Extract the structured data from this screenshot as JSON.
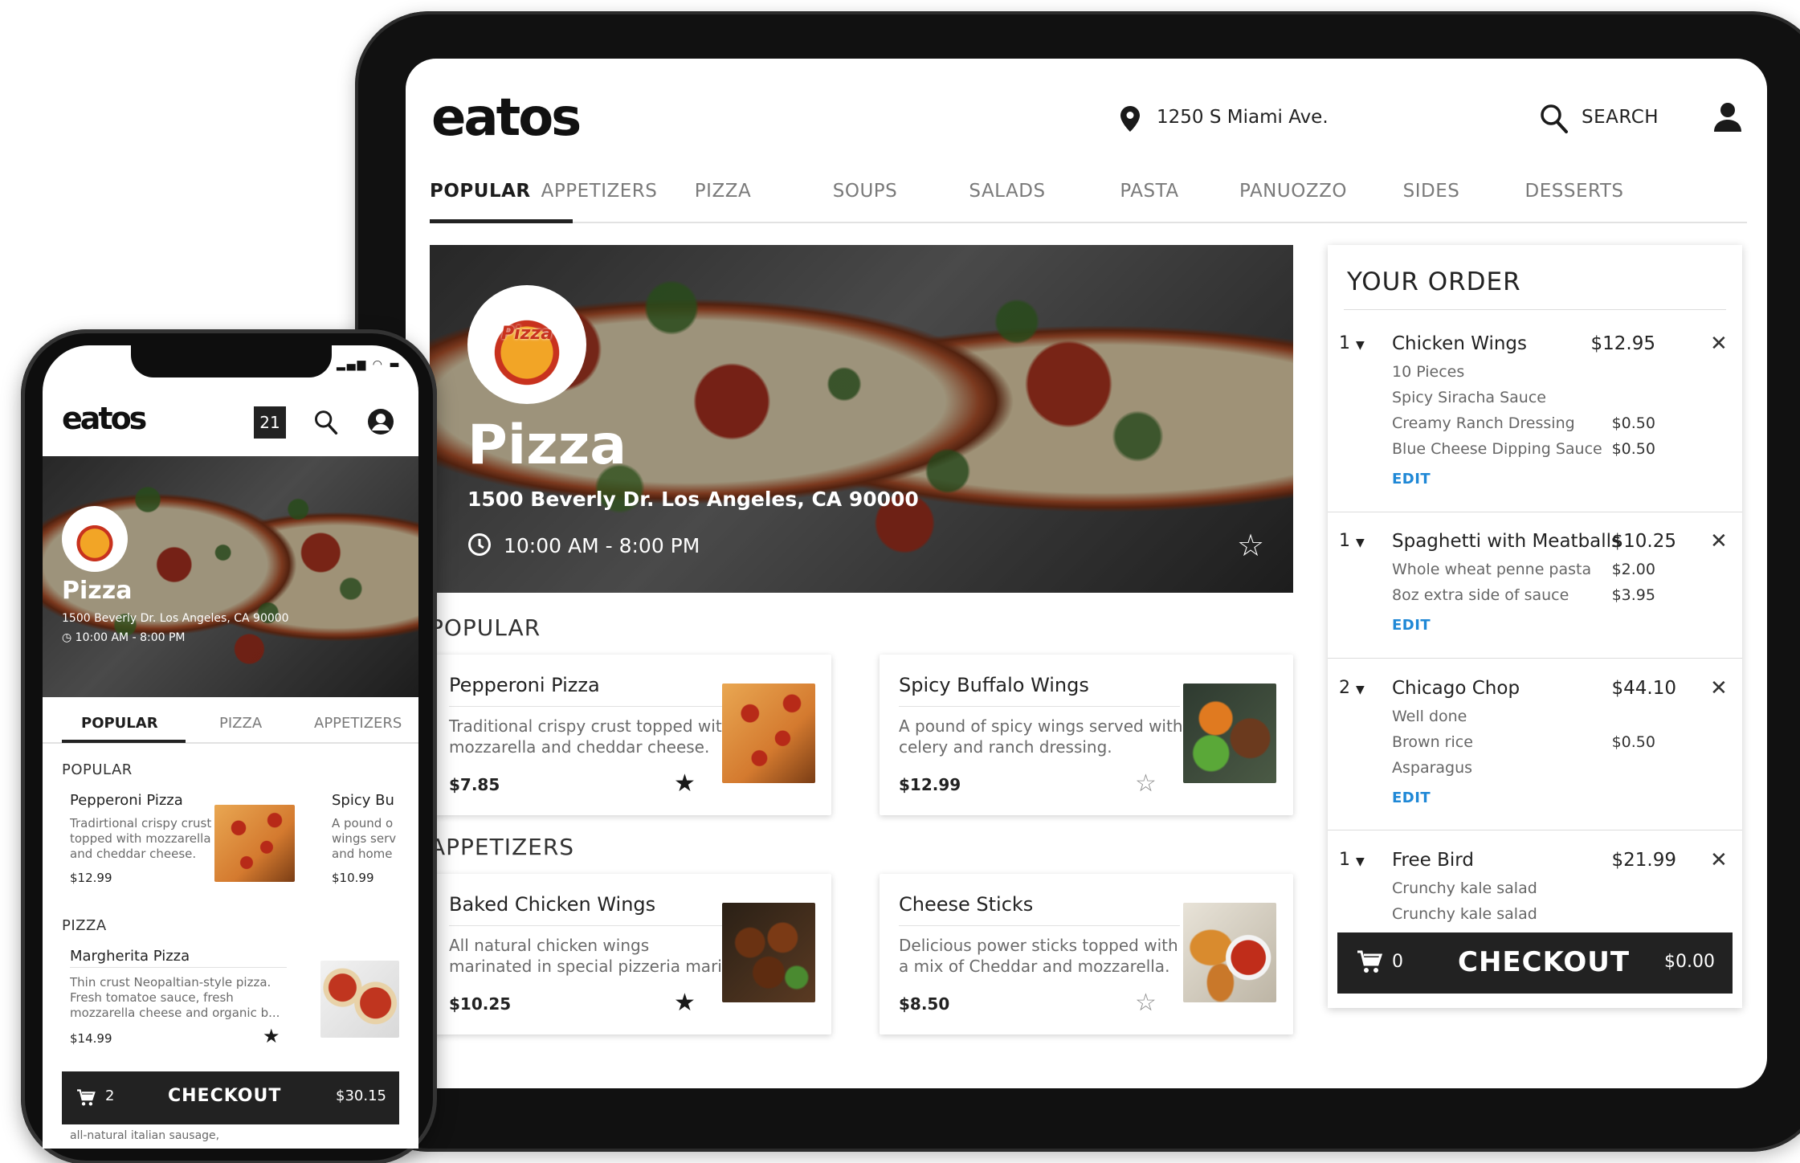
{
  "tablet": {
    "logo": "eatos",
    "address": "1250 S Miami Ave.",
    "search_label": "SEARCH",
    "tabs": [
      "POPULAR",
      "APPETIZERS",
      "PIZZA",
      "SOUPS",
      "SALADS",
      "PASTA",
      "PANUOZZO",
      "SIDES",
      "DESSERTS"
    ],
    "hero": {
      "badge_text": "Pizza",
      "title": "Pizza",
      "address": "1500 Beverly Dr. Los Angeles, CA 90000",
      "hours": "10:00 AM - 8:00 PM"
    },
    "sections": [
      {
        "title": "POPULAR",
        "items": [
          {
            "name": "Pepperoni Pizza",
            "desc1": "Traditional crispy crust topped with",
            "desc2": "mozzarella and cheddar cheese.",
            "price": "$7.85"
          },
          {
            "name": "Spicy Buffalo Wings",
            "desc1": "A pound of spicy wings served with",
            "desc2": "celery and ranch dressing.",
            "price": "$12.99"
          }
        ]
      },
      {
        "title": "APPETIZERS",
        "items": [
          {
            "name": "Baked Chicken Wings",
            "desc1": "All natural chicken wings",
            "desc2": "marinated in special pizzeria mari...",
            "price": "$10.25"
          },
          {
            "name": "Cheese Sticks",
            "desc1": "Delicious power sticks topped with",
            "desc2": "a mix of Cheddar and mozzarella.",
            "price": "$8.50"
          }
        ]
      }
    ],
    "order": {
      "title": "YOUR ORDER",
      "edit_label": "EDIT",
      "items": [
        {
          "qty": "1",
          "name": "Chicken Wings",
          "price": "$12.95",
          "mods": [
            {
              "label": "10 Pieces",
              "price": ""
            },
            {
              "label": "Spicy Siracha Sauce",
              "price": ""
            },
            {
              "label": "Creamy Ranch Dressing",
              "price": "$0.50"
            },
            {
              "label": "Blue Cheese Dipping Sauce",
              "price": "$0.50"
            }
          ]
        },
        {
          "qty": "1",
          "name": "Spaghetti with Meatballs",
          "price": "$10.25",
          "mods": [
            {
              "label": "Whole wheat penne pasta",
              "price": "$2.00"
            },
            {
              "label": "8oz extra side of sauce",
              "price": "$3.95"
            }
          ]
        },
        {
          "qty": "2",
          "name": "Chicago Chop",
          "price": "$44.10",
          "mods": [
            {
              "label": "Well done",
              "price": ""
            },
            {
              "label": "Brown rice",
              "price": "$0.50"
            },
            {
              "label": "Asparagus",
              "price": ""
            }
          ]
        },
        {
          "qty": "1",
          "name": "Free Bird",
          "price": "$21.99",
          "mods": [
            {
              "label": "Crunchy kale salad",
              "price": ""
            },
            {
              "label": "Crunchy kale salad",
              "price": ""
            }
          ]
        }
      ],
      "checkout": {
        "count": "0",
        "label": "CHECKOUT",
        "total": "$0.00"
      }
    }
  },
  "phone": {
    "logo": "eatos",
    "badge_number": "21",
    "hero": {
      "title": "Pizza",
      "address": "1500 Beverly Dr. Los Angeles, CA 90000",
      "hours": "10:00 AM - 8:00 PM"
    },
    "tabs": [
      "POPULAR",
      "PIZZA",
      "APPETIZERS"
    ],
    "sections": [
      {
        "title": "POPULAR",
        "item": {
          "name": "Pepperoni Pizza",
          "desc1": "Tradirtional crispy crust",
          "desc2": "topped with mozzarella",
          "desc3": "and cheddar cheese.",
          "price": "$12.99"
        },
        "peek": {
          "name": "Spicy Bu",
          "desc1": "A pound o",
          "desc2": "wings serv",
          "desc3": "and home",
          "price": "$10.99"
        }
      },
      {
        "title": "PIZZA",
        "item": {
          "name": "Margherita Pizza",
          "desc1": "Thin crust Neopaltian-style pizza.",
          "desc2": "Fresh tomatoe sauce, fresh",
          "desc3": "mozzarella cheese and organic b...",
          "price": "$14.99"
        }
      }
    ],
    "peek_text": "all-natural italian sausage,",
    "checkout": {
      "count": "2",
      "label": "CHECKOUT",
      "total": "$30.15"
    }
  },
  "colors": {
    "accent": "#1f88d6",
    "dark": "#222222",
    "pizza_red": "#c8321e"
  }
}
